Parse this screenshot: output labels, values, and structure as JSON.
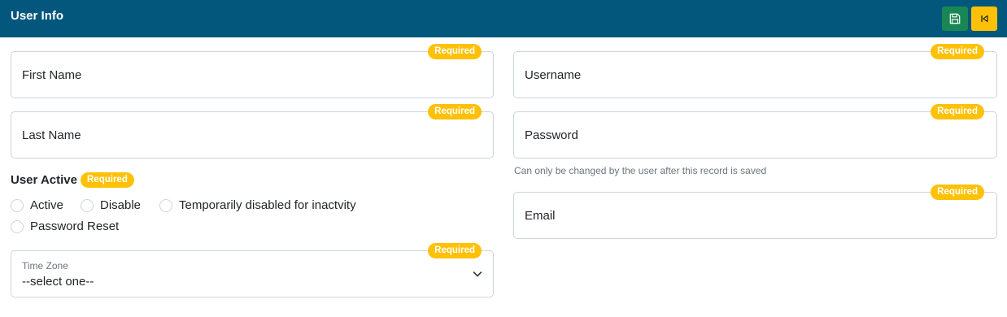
{
  "header": {
    "title": "User Info",
    "save_icon": "floppy-disk-icon",
    "back_icon": "step-back-icon"
  },
  "colors": {
    "header_bg": "#03577d",
    "save_button": "#198754",
    "back_button": "#ffc107",
    "required_badge": "#ffc107",
    "border": "#ced4da"
  },
  "badge": {
    "required": "Required"
  },
  "fields": {
    "first_name": "First Name",
    "last_name": "Last Name",
    "username": "Username",
    "password": "Password",
    "password_help": "Can only be changed by the user after this record is saved",
    "email": "Email"
  },
  "user_active": {
    "label": "User Active",
    "options": [
      "Active",
      "Disable",
      "Temporarily disabled for inactvity",
      "Password Reset"
    ]
  },
  "time_zone": {
    "label": "Time Zone",
    "value": "--select one--"
  }
}
